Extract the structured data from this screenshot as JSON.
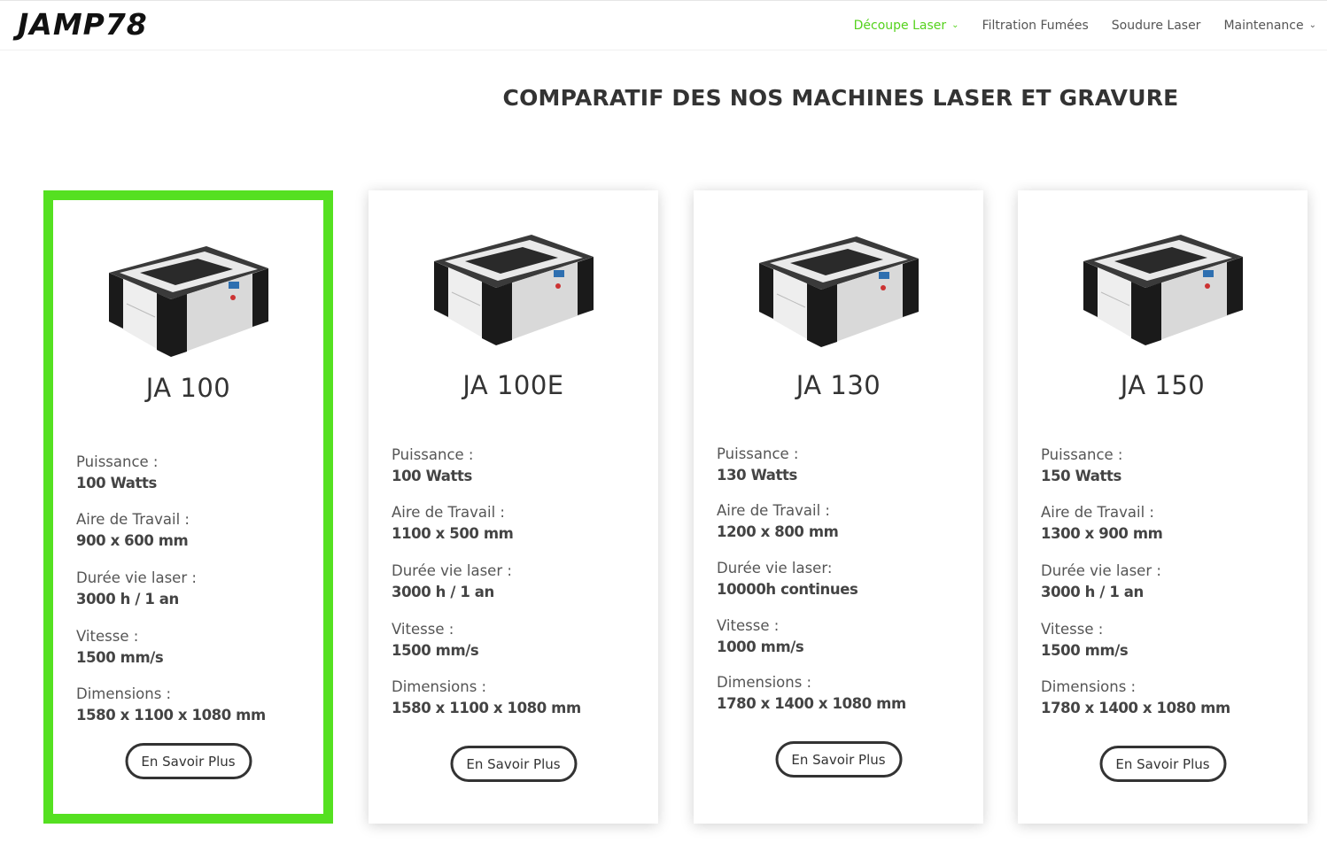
{
  "header": {
    "logo_text": "JAMP78",
    "nav": [
      {
        "label": "Découpe Laser",
        "has_dropdown": true,
        "active": true
      },
      {
        "label": "Filtration Fumées",
        "has_dropdown": false,
        "active": false
      },
      {
        "label": "Soudure Laser",
        "has_dropdown": false,
        "active": false
      },
      {
        "label": "Maintenance",
        "has_dropdown": true,
        "active": false
      }
    ],
    "accent_color": "#55d21d"
  },
  "page": {
    "title": "COMPARATIF DES NOS MACHINES LASER ET GRAVURE"
  },
  "cards": [
    {
      "name": "JA 100",
      "highlighted": true,
      "specs": [
        {
          "label": "Puissance :",
          "value": "100 Watts"
        },
        {
          "label": "Aire de Travail :",
          "value": "900 x 600 mm"
        },
        {
          "label": "Durée vie laser :",
          "value": "3000 h / 1 an"
        },
        {
          "label": "Vitesse :",
          "value": "1500 mm/s"
        },
        {
          "label": "Dimensions :",
          "value": "1580 x 1100 x 1080 mm"
        }
      ],
      "button": "En Savoir Plus"
    },
    {
      "name": "JA 100E",
      "highlighted": false,
      "specs": [
        {
          "label": "Puissance :",
          "value": "100 Watts"
        },
        {
          "label": "Aire de Travail :",
          "value": "1100 x 500 mm"
        },
        {
          "label": "Durée vie laser :",
          "value": "3000 h / 1 an"
        },
        {
          "label": "Vitesse :",
          "value": "1500 mm/s"
        },
        {
          "label": "Dimensions :",
          "value": "1580 x 1100 x 1080 mm"
        }
      ],
      "button": "En Savoir Plus"
    },
    {
      "name": "JA 130",
      "highlighted": false,
      "specs": [
        {
          "label": "Puissance :",
          "value": "130 Watts"
        },
        {
          "label": "Aire de Travail :",
          "value": "1200 x 800 mm"
        },
        {
          "label": "Durée vie laser:",
          "value": "10000h continues"
        },
        {
          "label": "Vitesse :",
          "value": "1000 mm/s"
        },
        {
          "label": "Dimensions :",
          "value": "1780 x 1400 x 1080 mm"
        }
      ],
      "button": "En Savoir Plus"
    },
    {
      "name": "JA 150",
      "highlighted": false,
      "specs": [
        {
          "label": "Puissance :",
          "value": "150 Watts"
        },
        {
          "label": "Aire de Travail :",
          "value": "1300 x 900 mm"
        },
        {
          "label": "Durée vie laser :",
          "value": "3000 h / 1 an"
        },
        {
          "label": "Vitesse :",
          "value": "1500 mm/s"
        },
        {
          "label": "Dimensions :",
          "value": "1780 x 1400 x 1080 mm"
        }
      ],
      "button": "En Savoir Plus"
    }
  ]
}
